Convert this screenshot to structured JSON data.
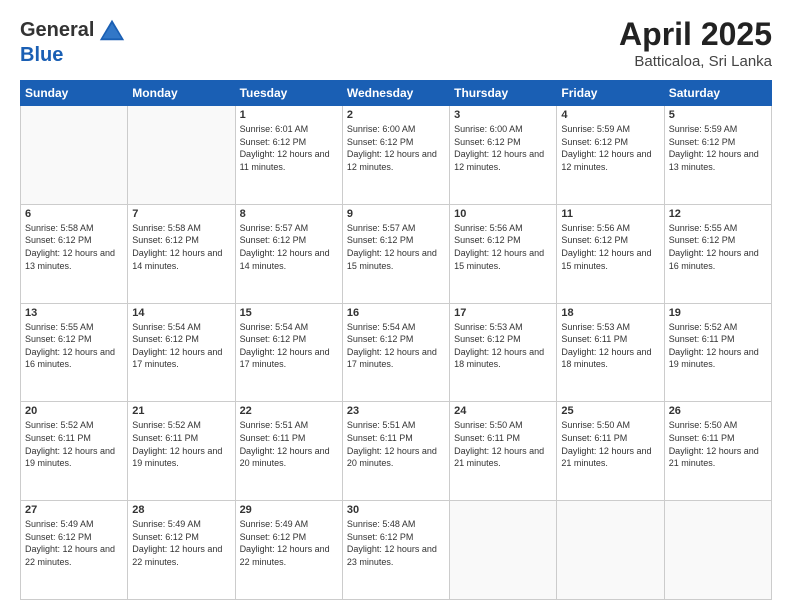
{
  "header": {
    "logo_line1": "General",
    "logo_line2": "Blue",
    "title": "April 2025",
    "subtitle": "Batticaloa, Sri Lanka"
  },
  "days_of_week": [
    "Sunday",
    "Monday",
    "Tuesday",
    "Wednesday",
    "Thursday",
    "Friday",
    "Saturday"
  ],
  "weeks": [
    [
      {
        "day": "",
        "info": ""
      },
      {
        "day": "",
        "info": ""
      },
      {
        "day": "1",
        "info": "Sunrise: 6:01 AM\nSunset: 6:12 PM\nDaylight: 12 hours and 11 minutes."
      },
      {
        "day": "2",
        "info": "Sunrise: 6:00 AM\nSunset: 6:12 PM\nDaylight: 12 hours and 12 minutes."
      },
      {
        "day": "3",
        "info": "Sunrise: 6:00 AM\nSunset: 6:12 PM\nDaylight: 12 hours and 12 minutes."
      },
      {
        "day": "4",
        "info": "Sunrise: 5:59 AM\nSunset: 6:12 PM\nDaylight: 12 hours and 12 minutes."
      },
      {
        "day": "5",
        "info": "Sunrise: 5:59 AM\nSunset: 6:12 PM\nDaylight: 12 hours and 13 minutes."
      }
    ],
    [
      {
        "day": "6",
        "info": "Sunrise: 5:58 AM\nSunset: 6:12 PM\nDaylight: 12 hours and 13 minutes."
      },
      {
        "day": "7",
        "info": "Sunrise: 5:58 AM\nSunset: 6:12 PM\nDaylight: 12 hours and 14 minutes."
      },
      {
        "day": "8",
        "info": "Sunrise: 5:57 AM\nSunset: 6:12 PM\nDaylight: 12 hours and 14 minutes."
      },
      {
        "day": "9",
        "info": "Sunrise: 5:57 AM\nSunset: 6:12 PM\nDaylight: 12 hours and 15 minutes."
      },
      {
        "day": "10",
        "info": "Sunrise: 5:56 AM\nSunset: 6:12 PM\nDaylight: 12 hours and 15 minutes."
      },
      {
        "day": "11",
        "info": "Sunrise: 5:56 AM\nSunset: 6:12 PM\nDaylight: 12 hours and 15 minutes."
      },
      {
        "day": "12",
        "info": "Sunrise: 5:55 AM\nSunset: 6:12 PM\nDaylight: 12 hours and 16 minutes."
      }
    ],
    [
      {
        "day": "13",
        "info": "Sunrise: 5:55 AM\nSunset: 6:12 PM\nDaylight: 12 hours and 16 minutes."
      },
      {
        "day": "14",
        "info": "Sunrise: 5:54 AM\nSunset: 6:12 PM\nDaylight: 12 hours and 17 minutes."
      },
      {
        "day": "15",
        "info": "Sunrise: 5:54 AM\nSunset: 6:12 PM\nDaylight: 12 hours and 17 minutes."
      },
      {
        "day": "16",
        "info": "Sunrise: 5:54 AM\nSunset: 6:12 PM\nDaylight: 12 hours and 17 minutes."
      },
      {
        "day": "17",
        "info": "Sunrise: 5:53 AM\nSunset: 6:12 PM\nDaylight: 12 hours and 18 minutes."
      },
      {
        "day": "18",
        "info": "Sunrise: 5:53 AM\nSunset: 6:11 PM\nDaylight: 12 hours and 18 minutes."
      },
      {
        "day": "19",
        "info": "Sunrise: 5:52 AM\nSunset: 6:11 PM\nDaylight: 12 hours and 19 minutes."
      }
    ],
    [
      {
        "day": "20",
        "info": "Sunrise: 5:52 AM\nSunset: 6:11 PM\nDaylight: 12 hours and 19 minutes."
      },
      {
        "day": "21",
        "info": "Sunrise: 5:52 AM\nSunset: 6:11 PM\nDaylight: 12 hours and 19 minutes."
      },
      {
        "day": "22",
        "info": "Sunrise: 5:51 AM\nSunset: 6:11 PM\nDaylight: 12 hours and 20 minutes."
      },
      {
        "day": "23",
        "info": "Sunrise: 5:51 AM\nSunset: 6:11 PM\nDaylight: 12 hours and 20 minutes."
      },
      {
        "day": "24",
        "info": "Sunrise: 5:50 AM\nSunset: 6:11 PM\nDaylight: 12 hours and 21 minutes."
      },
      {
        "day": "25",
        "info": "Sunrise: 5:50 AM\nSunset: 6:11 PM\nDaylight: 12 hours and 21 minutes."
      },
      {
        "day": "26",
        "info": "Sunrise: 5:50 AM\nSunset: 6:11 PM\nDaylight: 12 hours and 21 minutes."
      }
    ],
    [
      {
        "day": "27",
        "info": "Sunrise: 5:49 AM\nSunset: 6:12 PM\nDaylight: 12 hours and 22 minutes."
      },
      {
        "day": "28",
        "info": "Sunrise: 5:49 AM\nSunset: 6:12 PM\nDaylight: 12 hours and 22 minutes."
      },
      {
        "day": "29",
        "info": "Sunrise: 5:49 AM\nSunset: 6:12 PM\nDaylight: 12 hours and 22 minutes."
      },
      {
        "day": "30",
        "info": "Sunrise: 5:48 AM\nSunset: 6:12 PM\nDaylight: 12 hours and 23 minutes."
      },
      {
        "day": "",
        "info": ""
      },
      {
        "day": "",
        "info": ""
      },
      {
        "day": "",
        "info": ""
      }
    ]
  ]
}
